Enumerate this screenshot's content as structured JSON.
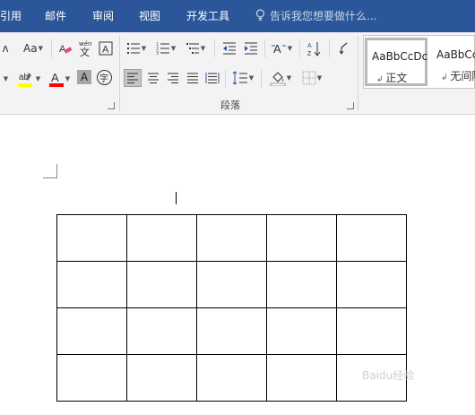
{
  "tabs": [
    {
      "label": "引用"
    },
    {
      "label": "邮件"
    },
    {
      "label": "审阅"
    },
    {
      "label": "视图"
    },
    {
      "label": "开发工具"
    }
  ],
  "tell_me": {
    "placeholder": "告诉我您想要做什么..."
  },
  "font_group": {
    "row1": {
      "font_size_btn": "Aa",
      "grow_font": "A"
    },
    "row2": {
      "highlight_color": "#ffff00",
      "font_color": "#ff0000",
      "char_shading": "A",
      "enclose_char": "字"
    }
  },
  "paragraph_group": {
    "label": "段落",
    "alignment_selected": "align-left"
  },
  "styles": {
    "items": [
      {
        "sample": "AaBbCcDc",
        "name": "正文",
        "selected": true
      },
      {
        "sample": "AaBbCcDc",
        "name": "无间隔",
        "selected": false
      }
    ]
  },
  "document": {
    "table": {
      "rows": 4,
      "cols": 5
    }
  },
  "watermark": "Baidu经验"
}
